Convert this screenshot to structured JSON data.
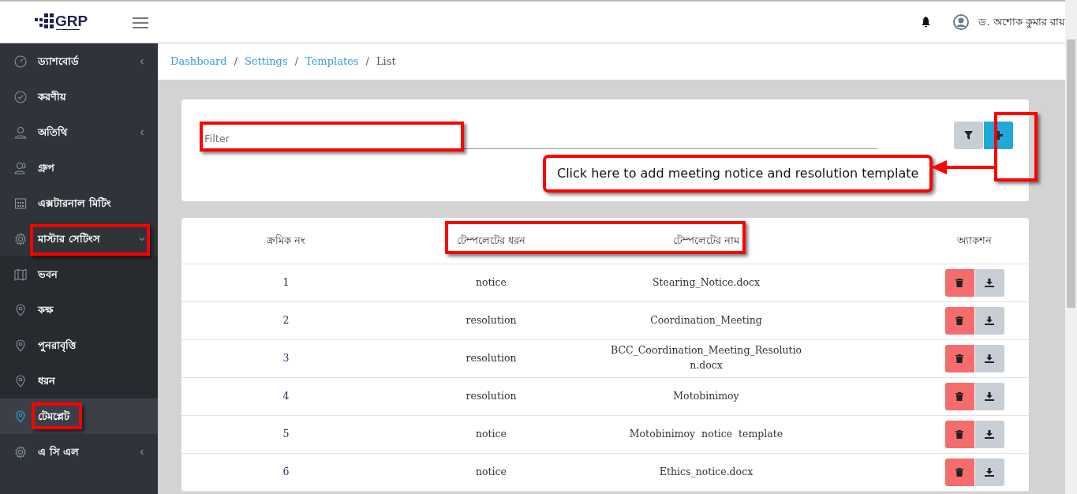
{
  "header": {
    "logo": "GRP",
    "user_name": "ড. অশোক কুমার রায়"
  },
  "sidebar": {
    "items": [
      {
        "label": "ড্যাশবোর্ড",
        "expandable": true,
        "expanded": false,
        "selected": false
      },
      {
        "label": "করণীয়",
        "selected": false
      },
      {
        "label": "অতিথি",
        "expandable": true,
        "expanded": false,
        "selected": false
      },
      {
        "label": "গ্রুপ",
        "selected": false
      },
      {
        "label": "এক্সটারনাল মিটিং",
        "selected": false
      },
      {
        "label": "মাস্টার সেটিংস",
        "expandable": true,
        "expanded": true,
        "selected": false,
        "children": [
          {
            "label": "ভবন",
            "selected": false
          },
          {
            "label": "কক্ষ",
            "selected": false
          },
          {
            "label": "পুনরাবৃত্তি",
            "selected": false
          },
          {
            "label": "ধরন",
            "selected": false
          },
          {
            "label": "টেমপ্লেট",
            "selected": true
          }
        ]
      },
      {
        "label": "এ সি এল",
        "expandable": true,
        "expanded": false,
        "selected": false
      }
    ]
  },
  "breadcrumb": {
    "separator": "/",
    "items": [
      {
        "label": "Dashboard",
        "link": true
      },
      {
        "label": "Settings",
        "link": true
      },
      {
        "label": "Templates",
        "link": true
      },
      {
        "label": "List",
        "link": false
      }
    ]
  },
  "filter": {
    "placeholder": "Filter"
  },
  "callout": "Click here to add meeting notice and resolution template",
  "table": {
    "columns": [
      "ক্রমিক নং",
      "টেম্পলেটের ধরন",
      "টেম্পলেটের নাম",
      "অ্যাকশন"
    ],
    "rows": [
      {
        "serial": "1",
        "type": "notice",
        "name": "Stearing_Notice.docx"
      },
      {
        "serial": "2",
        "type": "resolution",
        "name": "Coordination_Meeting"
      },
      {
        "serial": "3",
        "type": "resolution",
        "name": "BCC_Coordination_Meeting_Resolution.docx"
      },
      {
        "serial": "4",
        "type": "resolution",
        "name": "Motobinimoy"
      },
      {
        "serial": "5",
        "type": "notice",
        "name": "Motobinimoy  notice  template"
      },
      {
        "serial": "6",
        "type": "notice",
        "name": "Ethics_notice.docx"
      }
    ]
  }
}
